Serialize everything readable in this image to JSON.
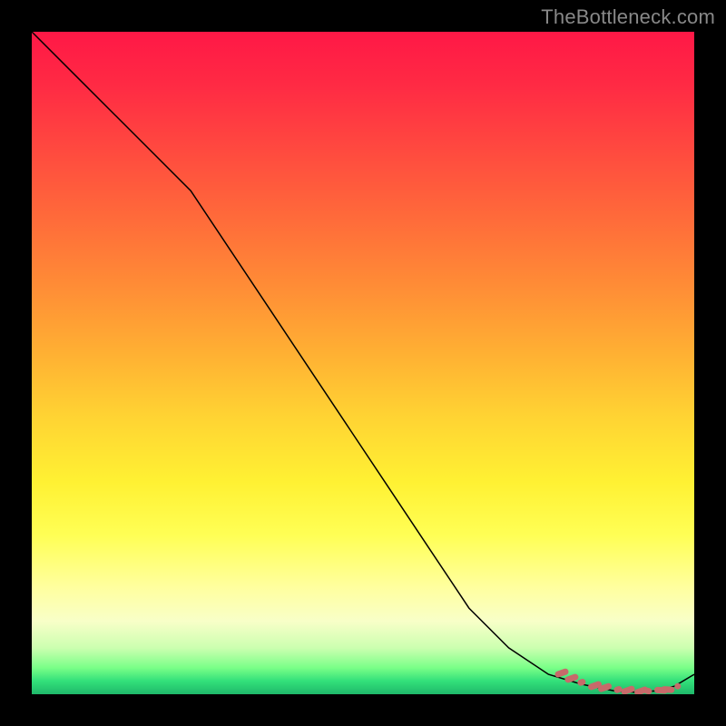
{
  "watermark": "TheBottleneck.com",
  "colors": {
    "dash_stroke": "#c76a6a",
    "curve_stroke": "#000000"
  },
  "chart_data": {
    "type": "line",
    "title": "",
    "xlabel": "",
    "ylabel": "",
    "xlim": [
      0,
      100
    ],
    "ylim": [
      0,
      100
    ],
    "grid": false,
    "series": [
      {
        "name": "bottleneck-curve",
        "x": [
          0,
          6,
          12,
          18,
          24,
          30,
          36,
          42,
          48,
          54,
          60,
          66,
          72,
          78,
          83,
          88,
          91,
          94,
          97,
          100
        ],
        "y": [
          100,
          94,
          88,
          82,
          76,
          67,
          58,
          49,
          40,
          31,
          22,
          13,
          7,
          3,
          1.5,
          0.5,
          0.3,
          0.5,
          1.2,
          3
        ]
      }
    ],
    "annotations": [
      {
        "name": "optimum-dash",
        "style": "dashed-dots",
        "points_x": [
          80,
          81.5,
          83,
          85,
          86.5,
          88.5,
          90,
          92,
          93,
          95,
          96
        ],
        "points_y": [
          3.2,
          2.4,
          1.8,
          1.3,
          1.0,
          0.7,
          0.6,
          0.5,
          0.5,
          0.6,
          0.7
        ]
      }
    ]
  }
}
